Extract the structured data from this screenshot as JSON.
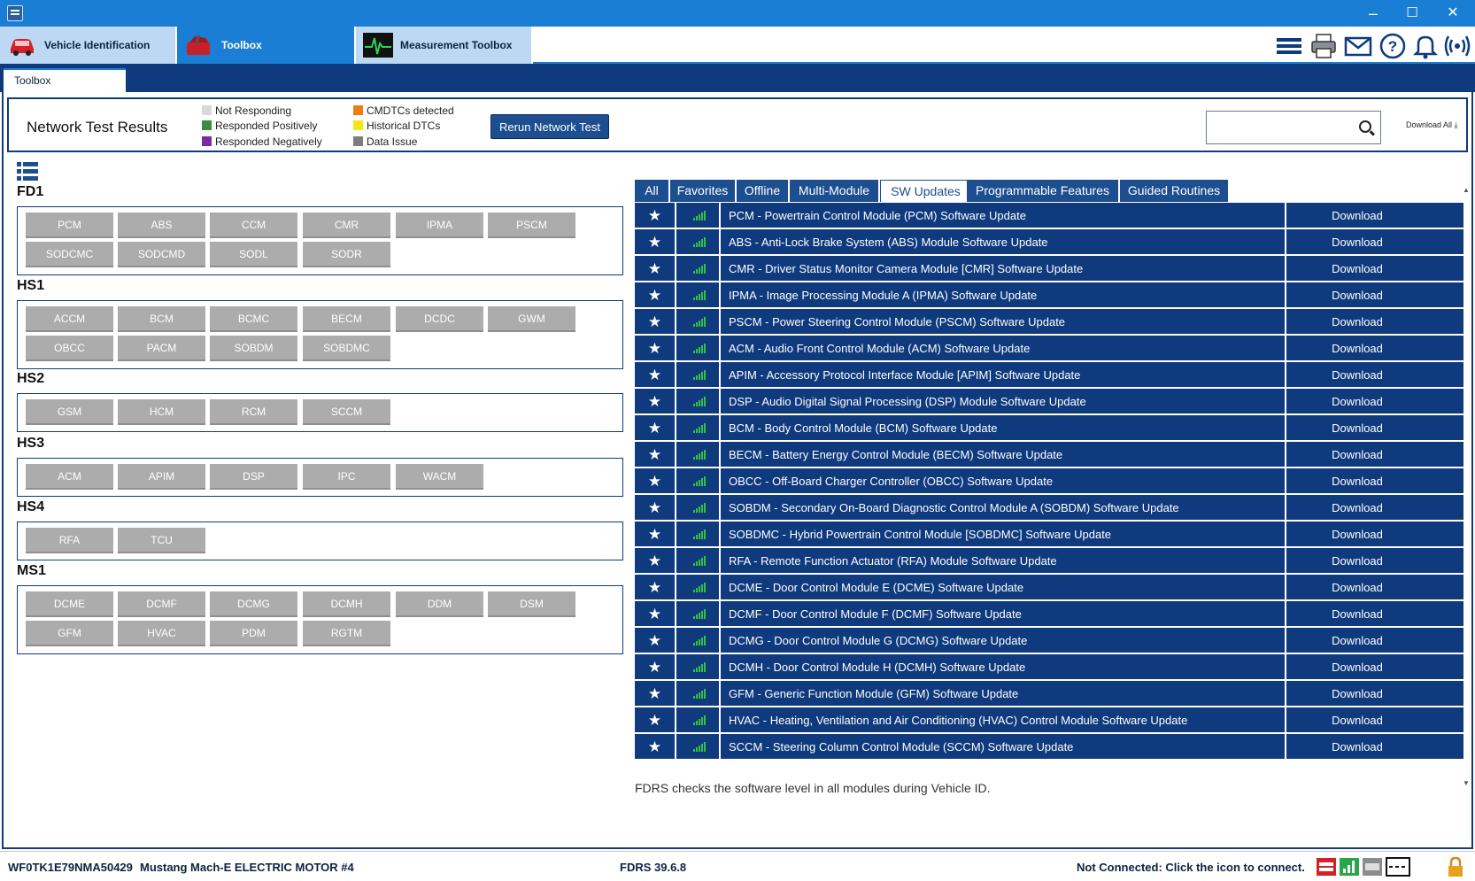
{
  "window": {
    "minimize": "–",
    "maximize": "☐",
    "close": "✕"
  },
  "top_tabs": [
    {
      "label": "Vehicle Identification",
      "icon": "car-icon"
    },
    {
      "label": "Toolbox",
      "icon": "toolbox-icon"
    },
    {
      "label": "Measurement Toolbox",
      "icon": "oscilloscope-icon"
    }
  ],
  "header_icons": [
    "menu-icon",
    "printer-icon",
    "mail-icon",
    "help-icon",
    "bell-icon",
    "wireless-icon"
  ],
  "strip": {
    "tab": "Toolbox"
  },
  "network": {
    "title": "Network Test Results",
    "legend": [
      {
        "label": "Not Responding",
        "color": "#d9d9d9"
      },
      {
        "label": "Responded Positively",
        "color": "#3a8c3e"
      },
      {
        "label": "Responded Negatively",
        "color": "#7a2a9e"
      },
      {
        "label": "CMDTCs detected",
        "color": "#f07c16"
      },
      {
        "label": "Historical DTCs",
        "color": "#f5e614"
      },
      {
        "label": "Data Issue",
        "color": "#7d7d7d"
      }
    ],
    "rerun": "Rerun Network Test",
    "search_value": "",
    "download_all": "Download All"
  },
  "groups": [
    {
      "name": "FD1",
      "modules": [
        "PCM",
        "ABS",
        "CCM",
        "CMR",
        "IPMA",
        "PSCM",
        "SODCMC",
        "SODCMD",
        "SODL",
        "SODR"
      ]
    },
    {
      "name": "HS1",
      "modules": [
        "ACCM",
        "BCM",
        "BCMC",
        "BECM",
        "DCDC",
        "GWM",
        "OBCC",
        "PACM",
        "SOBDM",
        "SOBDMC"
      ]
    },
    {
      "name": "HS2",
      "modules": [
        "GSM",
        "HCM",
        "RCM",
        "SCCM"
      ]
    },
    {
      "name": "HS3",
      "modules": [
        "ACM",
        "APIM",
        "DSP",
        "IPC",
        "WACM"
      ]
    },
    {
      "name": "HS4",
      "modules": [
        "RFA",
        "TCU"
      ]
    },
    {
      "name": "MS1",
      "modules": [
        "DCME",
        "DCMF",
        "DCMG",
        "DCMH",
        "DDM",
        "DSM",
        "GFM",
        "HVAC",
        "PDM",
        "RGTM"
      ]
    }
  ],
  "filter_tabs": [
    "All",
    "Favorites",
    "Offline",
    "Multi-Module",
    "SW Updates",
    "Programmable Features",
    "Guided Routines"
  ],
  "active_filter": "SW Updates",
  "updates": [
    "PCM - Powertrain Control Module (PCM) Software Update",
    "ABS - Anti-Lock Brake System (ABS) Module Software Update",
    "CMR - Driver Status Monitor Camera Module [CMR] Software Update",
    "IPMA - Image Processing Module A (IPMA) Software Update",
    "PSCM - Power Steering Control Module (PSCM) Software Update",
    "ACM - Audio Front Control Module (ACM) Software Update",
    "APIM - Accessory Protocol Interface Module [APIM] Software Update",
    "DSP - Audio Digital Signal Processing (DSP) Module Software Update",
    "BCM - Body Control Module (BCM) Software Update",
    "BECM - Battery Energy Control Module (BECM) Software Update",
    "OBCC - Off-Board Charger Controller (OBCC) Software Update",
    "SOBDM - Secondary On-Board Diagnostic Control Module A (SOBDM) Software Update",
    "SOBDMC - Hybrid Powertrain Control Module [SOBDMC] Software Update",
    "RFA - Remote Function Actuator (RFA) Module Software Update",
    "DCME - Door Control Module E (DCME) Software Update",
    "DCMF - Door Control Module F (DCMF) Software Update",
    "DCMG - Door Control Module G (DCMG) Software Update",
    "DCMH - Door Control Module H (DCMH) Software Update",
    "GFM - Generic Function Module (GFM) Software Update",
    "HVAC - Heating, Ventilation and Air Conditioning (HVAC) Control Module Software Update",
    "SCCM - Steering Column Control Module (SCCM) Software Update"
  ],
  "download_label": "Download",
  "note": "FDRS checks the software level in all modules during Vehicle ID.",
  "status": {
    "vin": "WF0TK1E79NMA50429",
    "vehicle": "Mustang Mach-E ELECTRIC MOTOR #4",
    "version": "FDRS 39.6.8",
    "connection": "Not Connected: Click the icon to connect."
  }
}
